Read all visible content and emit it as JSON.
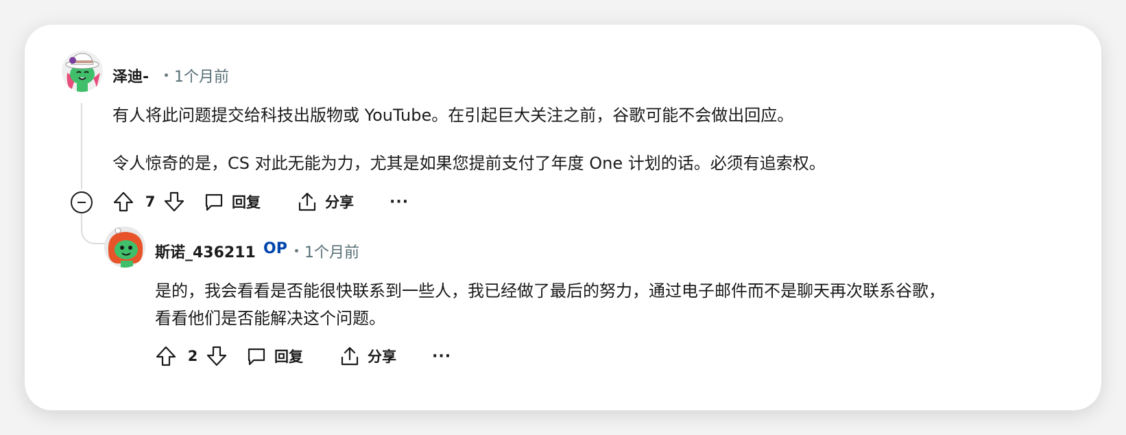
{
  "comment1": {
    "username": "泽迪-",
    "time": "1个月前",
    "paragraph1": "有人将此问题提交给科技出版物或 YouTube。在引起巨大关注之前，谷歌可能不会做出回应。",
    "paragraph2": "令人惊奇的是，CS 对此无能为力，尤其是如果您提前支付了年度 One 计划的话。必须有追索权。",
    "score": "7",
    "reply_label": "回复",
    "share_label": "分享",
    "more_label": "···"
  },
  "comment2": {
    "username": "斯诺_436211",
    "op_badge": "OP",
    "time": "1个月前",
    "line1": "是的，我会看看是否能很快联系到一些人，我已经做了最后的努力，通过电子邮件而不是聊天再次联系谷歌，",
    "line2": "看看他们是否能解决这个问题。",
    "score": "2",
    "reply_label": "回复",
    "share_label": "分享",
    "more_label": "···"
  },
  "colors": {
    "op_badge": "#0045ac",
    "meta_text": "#576f76",
    "avatar1_bg": "#f0f0f0",
    "avatar2_bg": "#e9e9e9"
  },
  "icons": [
    "upvote-icon",
    "downvote-icon",
    "comment-bubble-icon",
    "share-icon",
    "collapse-icon"
  ]
}
